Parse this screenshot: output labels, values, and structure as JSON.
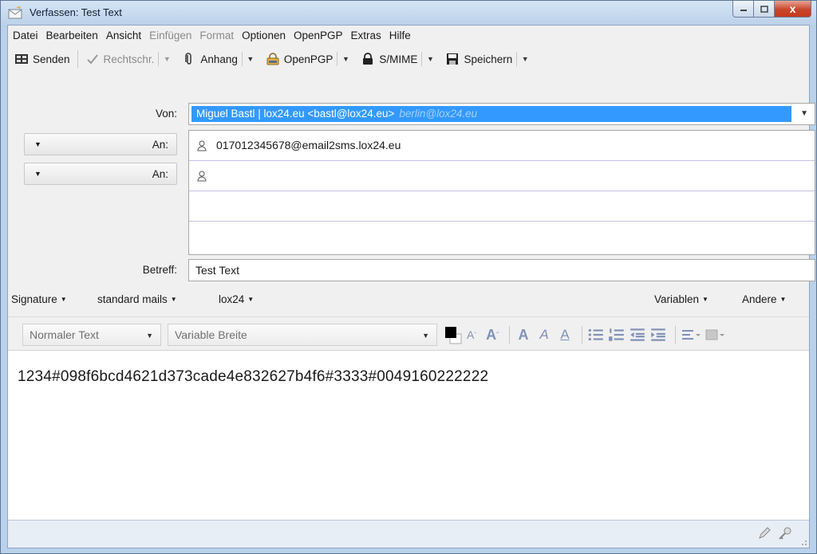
{
  "window": {
    "title": "Verfassen: Test Text",
    "close_glyph": "x"
  },
  "menu": {
    "items": [
      {
        "label": "Datei",
        "enabled": true
      },
      {
        "label": "Bearbeiten",
        "enabled": true
      },
      {
        "label": "Ansicht",
        "enabled": true
      },
      {
        "label": "Einfügen",
        "enabled": false
      },
      {
        "label": "Format",
        "enabled": false
      },
      {
        "label": "Optionen",
        "enabled": true
      },
      {
        "label": "OpenPGP",
        "enabled": true
      },
      {
        "label": "Extras",
        "enabled": true
      },
      {
        "label": "Hilfe",
        "enabled": true
      }
    ]
  },
  "toolbar": {
    "send_label": "Senden",
    "spell_label": "Rechtschr.",
    "attach_label": "Anhang",
    "openpgp_label": "OpenPGP",
    "smime_label": "S/MIME",
    "save_label": "Speichern"
  },
  "header": {
    "from_label": "Von:",
    "from_value": "Miguel Bastl | lox24.eu <bastl@lox24.eu>",
    "from_alias": "berlin@lox24.eu",
    "to_label": "An:",
    "recipients": [
      "017012345678@email2sms.lox24.eu",
      ""
    ],
    "subject_label": "Betreff:",
    "subject_value": "Test Text"
  },
  "sigbar": {
    "signature": "Signature",
    "standard_mails": "standard mails",
    "lox24": "lox24",
    "variablen": "Variablen",
    "andere": "Andere"
  },
  "format": {
    "paragraph": "Normaler Text",
    "font": "Variable Breite",
    "text_color": "#000000",
    "icon_color": "#8090b8"
  },
  "body": {
    "text": "1234#098f6bcd4621d373cade4e832627b4f6#3333#0049160222222"
  }
}
